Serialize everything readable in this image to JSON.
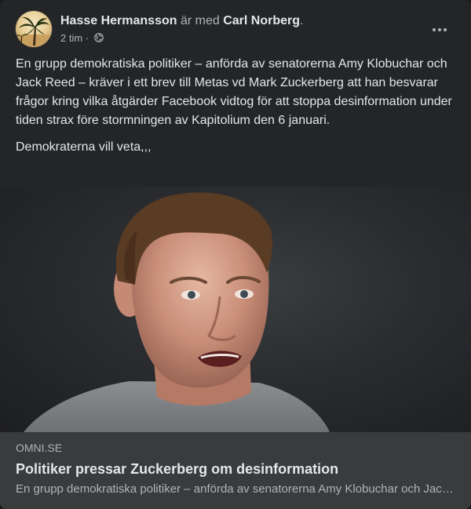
{
  "post": {
    "author": "Hasse Hermansson",
    "with_text": " är med ",
    "tagged": "Carl Norberg",
    "tagged_suffix": ".",
    "time": "2 tim",
    "separator": " · ",
    "privacy_icon": "globe-icon",
    "more_icon": "more-horizontal-icon",
    "paragraphs": [
      "En grupp demokratiska politiker – anförda av senatorerna Amy Klobuchar och Jack Reed – kräver i ett brev till Metas vd Mark Zuckerberg att han besvarar frågor kring vilka åtgärder Facebook vidtog för att stoppa desinformation under tiden strax före stormningen av Kapitolium den 6 januari.",
      "Demokraterna vill veta,,,"
    ]
  },
  "link_preview": {
    "domain": "OMNI.SE",
    "title": "Politiker pressar Zuckerberg om desinformation",
    "description": "En grupp demokratiska politiker – anförda av senatorerna Amy Klobuchar och Jack Reed – kräver i ett brev till Metas vd Mark Zuckerberg..."
  },
  "colors": {
    "card_background": "#242526",
    "page_background": "#18191a",
    "link_box_background": "#3a3b3c",
    "primary_text": "#e4e6eb",
    "secondary_text": "#b0b3b8"
  }
}
